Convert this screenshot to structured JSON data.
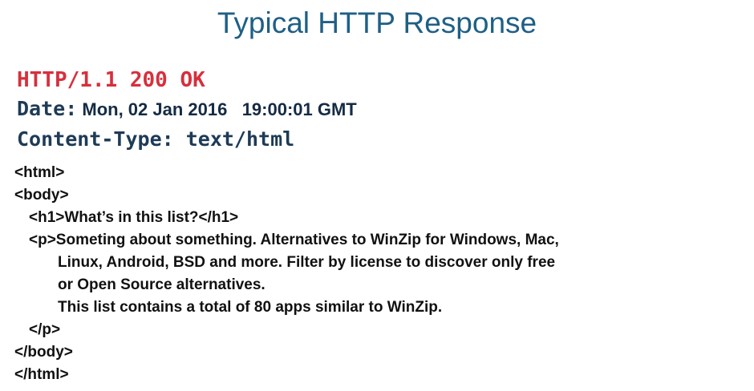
{
  "title": "Typical HTTP Response",
  "status_line": "HTTP/1.1 200 OK",
  "headers": {
    "date_name": "Date:",
    "date_value": " Mon, 02 Jan 2016   19:00:01 GMT",
    "content_type": "Content-Type: text/html"
  },
  "body_lines": [
    "<html>",
    "<body>",
    "<h1>What’s in this list?</h1>",
    "<p>Someting about something. Alternatives to WinZip for Windows, Mac,",
    "Linux, Android, BSD and more. Filter by license to discover only free",
    "or Open Source alternatives.",
    "This list contains a total of 80 apps similar to WinZip.",
    "</p>",
    "</body>",
    "</html>"
  ],
  "colors": {
    "title": "#1f5f86",
    "status": "#d6303d",
    "header": "#1e3b57",
    "body_text": "#111111"
  }
}
